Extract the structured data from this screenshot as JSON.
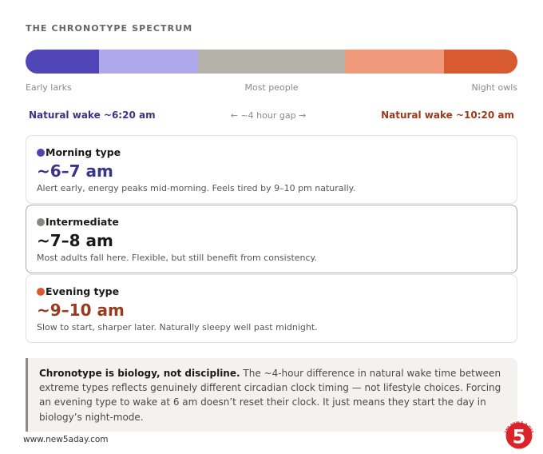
{
  "title": "THE CHRONOTYPE SPECTRUM",
  "colors": {
    "morning": "#4f43b6",
    "morning_text": "#3c3489",
    "intermediate": "#888780",
    "evening": "#d85a30",
    "evening_text": "#993c1d",
    "logo_red": "#d9252a"
  },
  "spectrum": {
    "segments": [
      {
        "color": "#5046b8",
        "share": 0.149
      },
      {
        "color": "#afa9ec",
        "share": 0.201
      },
      {
        "color": "#b4b2a9",
        "share": 0.299
      },
      {
        "color": "#f0997b",
        "share": 0.201
      },
      {
        "color": "#d85a30",
        "share": 0.15
      }
    ],
    "label_left": "Early larks",
    "label_mid": "Most people",
    "label_right": "Night owls"
  },
  "wake": {
    "left": "Natural wake ~6:20 am",
    "gap": "← ~4 hour gap →",
    "right": "Natural wake ~10:20 am"
  },
  "cards": [
    {
      "name": "Morning type",
      "time": "~6–7 am",
      "desc": "Alert early, energy peaks mid-morning. Feels tired by 9–10 pm naturally."
    },
    {
      "name": "Intermediate",
      "time": "~7–8 am",
      "desc": "Most adults fall here. Flexible, but still benefit from consistency."
    },
    {
      "name": "Evening type",
      "time": "~9–10 am",
      "desc": "Slow to start, sharper later. Naturally sleepy well past midnight."
    }
  ],
  "note": {
    "bold": "Chronotype is biology, not discipline.",
    "text": " The ~4-hour difference in natural wake time between extreme types reflects genuinely different circadian clock timing — not lifestyle choices. Forcing an evening type to wake at 6 am doesn’t reset their clock. It just means they start the day in biology’s night-mode."
  },
  "footer": {
    "site": "www.new5aday.com",
    "logo_number": "5",
    "logo_text": "THE NEW 5-A-DAY"
  }
}
